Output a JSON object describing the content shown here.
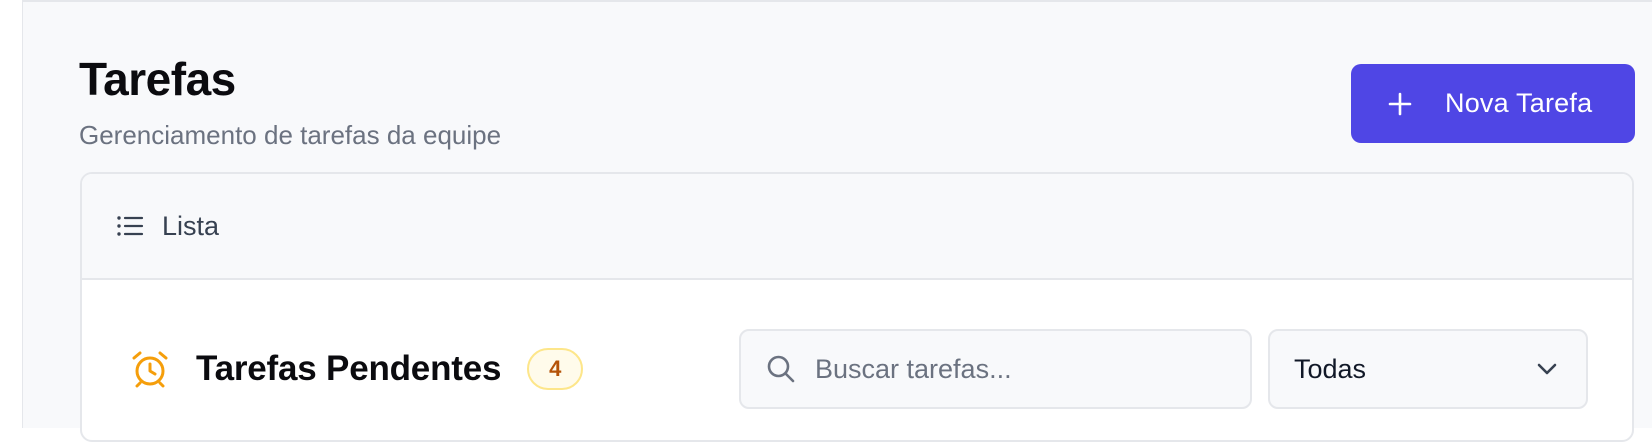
{
  "header": {
    "title": "Tarefas",
    "subtitle": "Gerenciamento de tarefas da equipe",
    "new_task_label": "Nova Tarefa"
  },
  "tabs": [
    {
      "label": "Lista",
      "icon": "list-icon"
    }
  ],
  "section": {
    "title": "Tarefas Pendentes",
    "icon": "alarm-clock-icon",
    "count": "4"
  },
  "search": {
    "placeholder": "Buscar tarefas...",
    "value": "",
    "icon": "search-icon"
  },
  "filter": {
    "selected": "Todas",
    "icon": "chevron-down-icon"
  },
  "colors": {
    "accent": "#4f46e5",
    "alarm": "#f59e0b",
    "badge_text": "#b45309",
    "badge_bg": "#fffbeb",
    "badge_border": "#fde68a"
  }
}
